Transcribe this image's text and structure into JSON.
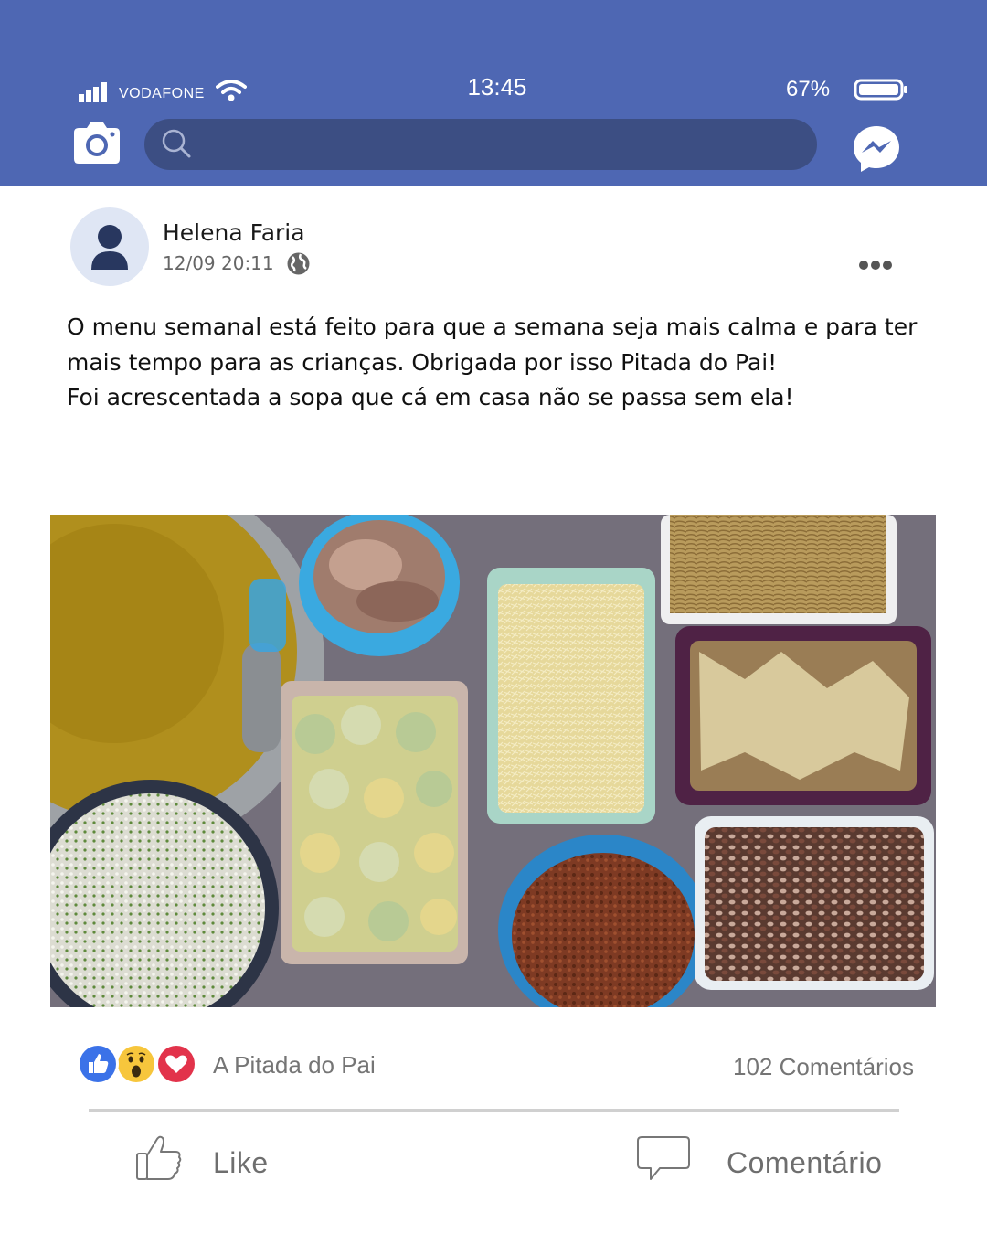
{
  "status_bar": {
    "carrier": "VODAFONE",
    "time": "13:45",
    "battery_percent": "67%",
    "battery_level": 0.67
  },
  "header": {
    "search_placeholder": "",
    "icons": [
      "camera-icon",
      "search-icon",
      "messenger-icon"
    ]
  },
  "post": {
    "author": "Helena Faria",
    "timestamp": "12/09 20:11",
    "visibility_icon": "globe-icon",
    "text_lines": [
      "O menu semanal está feito para que a semana seja mais calma e para ter",
      "mais tempo para as crianças. Obrigada por isso Pitada do Pai!",
      "Foi acrescentada a sopa que cá em casa não se passa sem ela!"
    ]
  },
  "engagement": {
    "reaction_icons": [
      "like-reaction-icon",
      "wow-reaction-icon",
      "love-reaction-icon"
    ],
    "reacted_by": "A Pitada do Pai",
    "comments": "102 Comentários"
  },
  "actions": {
    "like_label": "Like",
    "comment_label": "Comentário"
  },
  "colors": {
    "top_bar": "#4e67b3",
    "search_bar": "#3c4e83",
    "like_blue": "#3b72e8",
    "love_red": "#e2334b",
    "wow_yellow": "#f7c63c"
  }
}
